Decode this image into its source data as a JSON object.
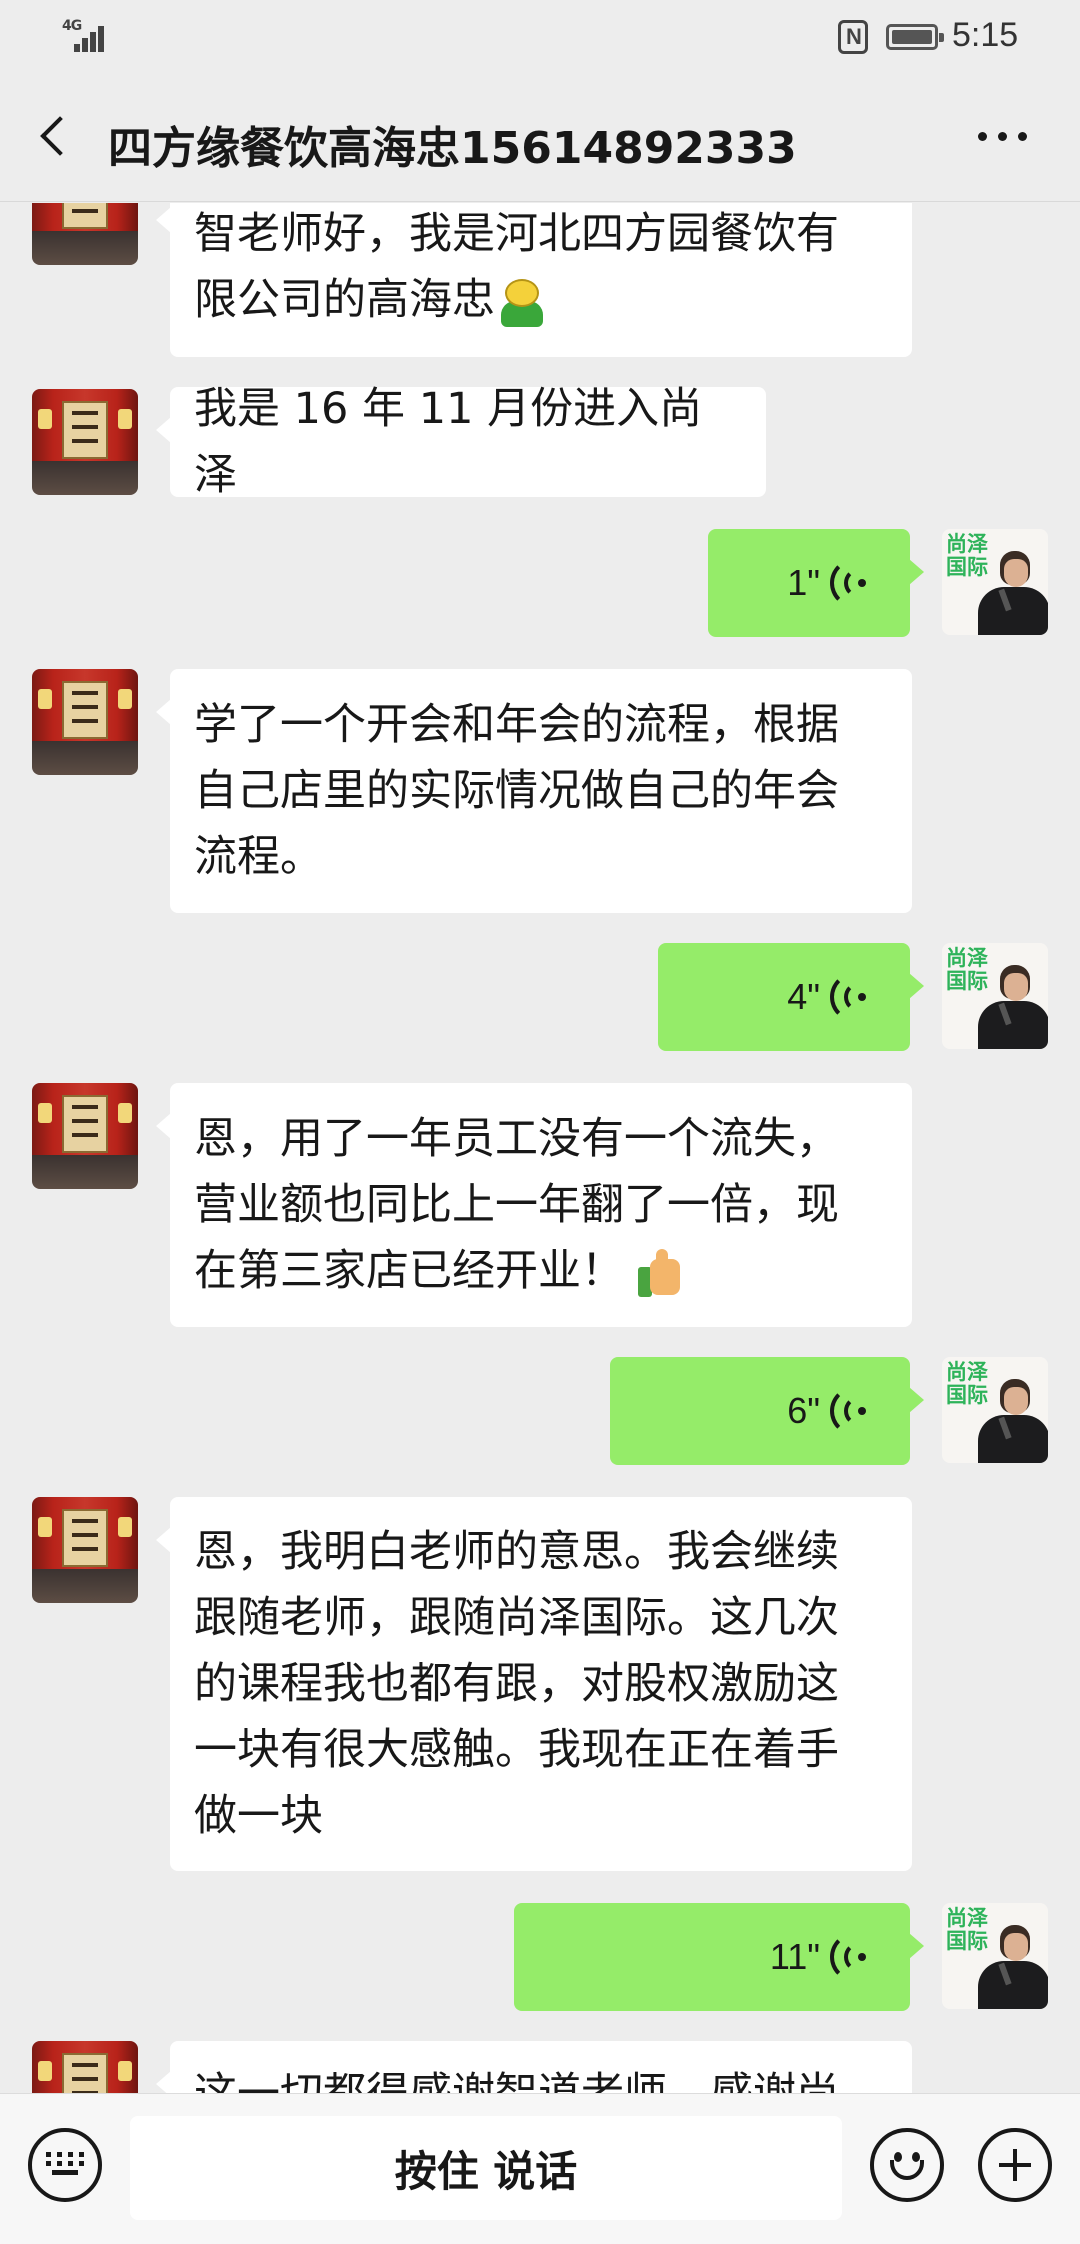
{
  "status_bar": {
    "network": "4G",
    "time": "5:15"
  },
  "header": {
    "title": "四方缘餐饮高海忠15614892333"
  },
  "messages": [
    {
      "side": "left",
      "type": "text",
      "lines": [
        "智老师好，我是河北四方园餐饮有",
        "限公司的高海忠"
      ],
      "emoji": "smile-emoji"
    },
    {
      "side": "left",
      "type": "text",
      "lines": [
        "我是 16 年 11 月份进入尚泽"
      ]
    },
    {
      "side": "right",
      "type": "voice",
      "duration": "1\""
    },
    {
      "side": "left",
      "type": "text",
      "lines": [
        "学了一个开会和年会的流程，根据",
        "自己店里的实际情况做自己的年会",
        "流程。"
      ]
    },
    {
      "side": "right",
      "type": "voice",
      "duration": "4\""
    },
    {
      "side": "left",
      "type": "text",
      "lines": [
        "恩，用了一年员工没有一个流失，",
        "营业额也同比上一年翻了一倍，现",
        "在第三家店已经开业！"
      ],
      "emoji": "thumbs-up-emoji"
    },
    {
      "side": "right",
      "type": "voice",
      "duration": "6\""
    },
    {
      "side": "left",
      "type": "text",
      "lines": [
        "恩，我明白老师的意思。我会继续",
        "跟随老师，跟随尚泽国际。这几次",
        "的课程我也都有跟，对股权激励这",
        "一块有很大感触。我现在正在着手",
        "做一块"
      ]
    },
    {
      "side": "right",
      "type": "voice",
      "duration": "11\""
    },
    {
      "side": "left",
      "type": "text",
      "lines": [
        "这一切都得感谢智道老师，感谢尚"
      ]
    }
  ],
  "avatars": {
    "self_brand_text": "尚泽国际"
  },
  "input_bar": {
    "hold_to_talk_label": "按住 说话"
  },
  "colors": {
    "background": "#ededed",
    "voice_bubble": "#95ec69",
    "text_bubble": "#ffffff",
    "brand_green": "#2eb35a"
  },
  "icons": [
    "back-icon",
    "more-icon",
    "voice-wave-icon",
    "keyboard-icon",
    "emoji-icon",
    "plus-icon"
  ]
}
